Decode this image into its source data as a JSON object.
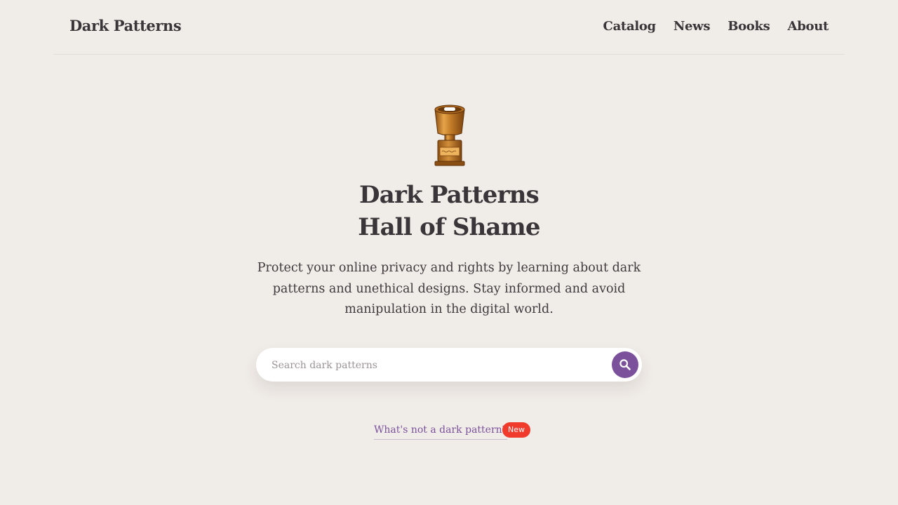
{
  "header": {
    "logo": "Dark Patterns",
    "nav": [
      {
        "label": "Catalog"
      },
      {
        "label": "News"
      },
      {
        "label": "Books"
      },
      {
        "label": "About"
      }
    ]
  },
  "hero": {
    "icon": "trophy-icon",
    "title_line1": "Dark Patterns",
    "title_line2": "Hall of Shame",
    "description": "Protect your online privacy and rights by learning about dark patterns and unethical designs. Stay informed and avoid manipulation in the digital world."
  },
  "search": {
    "placeholder": "Search dark patterns",
    "value": "",
    "button_icon": "search-icon"
  },
  "footer_link": {
    "label": "What's not a dark pattern?",
    "badge": "New"
  },
  "colors": {
    "background": "#f0ece8",
    "text": "#3a3538",
    "accent": "#7b519b",
    "badge": "#f03a2c"
  }
}
